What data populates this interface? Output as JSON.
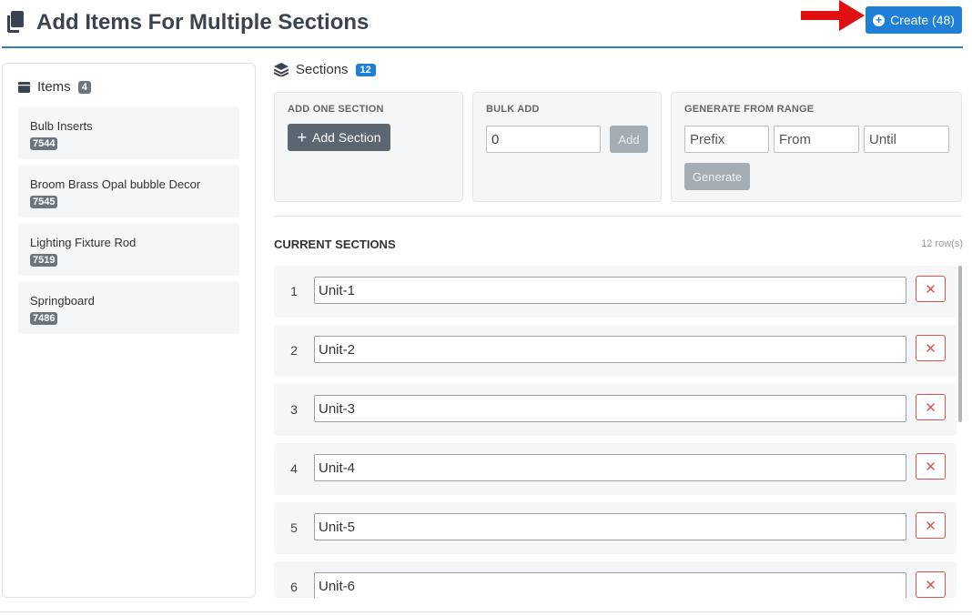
{
  "header": {
    "title": "Add Items For Multiple Sections",
    "create_label": "Create (48)"
  },
  "items": {
    "label": "Items",
    "count": "4",
    "list": [
      {
        "name": "Bulb Inserts",
        "id": "7544"
      },
      {
        "name": "Broom Brass Opal bubble Decor",
        "id": "7545"
      },
      {
        "name": "Lighting Fixture Rod",
        "id": "7519"
      },
      {
        "name": "Springboard",
        "id": "7486"
      }
    ]
  },
  "sections": {
    "label": "Sections",
    "count": "12",
    "add_one": {
      "label": "ADD ONE SECTION",
      "button": "Add Section"
    },
    "bulk_add": {
      "label": "BULK ADD",
      "value": "0",
      "button": "Add"
    },
    "range": {
      "label": "GENERATE FROM RANGE",
      "prefix_placeholder": "Prefix",
      "from_placeholder": "From",
      "until_placeholder": "Until",
      "button": "Generate"
    },
    "current_label": "CURRENT SECTIONS",
    "rows_count": "12 row(s)",
    "rows": [
      {
        "num": "1",
        "value": "Unit-1"
      },
      {
        "num": "2",
        "value": "Unit-2"
      },
      {
        "num": "3",
        "value": "Unit-3"
      },
      {
        "num": "4",
        "value": "Unit-4"
      },
      {
        "num": "5",
        "value": "Unit-5"
      },
      {
        "num": "6",
        "value": "Unit-6"
      }
    ]
  },
  "colors": {
    "primary": "#1e7fd8",
    "danger": "#d9534f",
    "arrow": "#e01010"
  }
}
